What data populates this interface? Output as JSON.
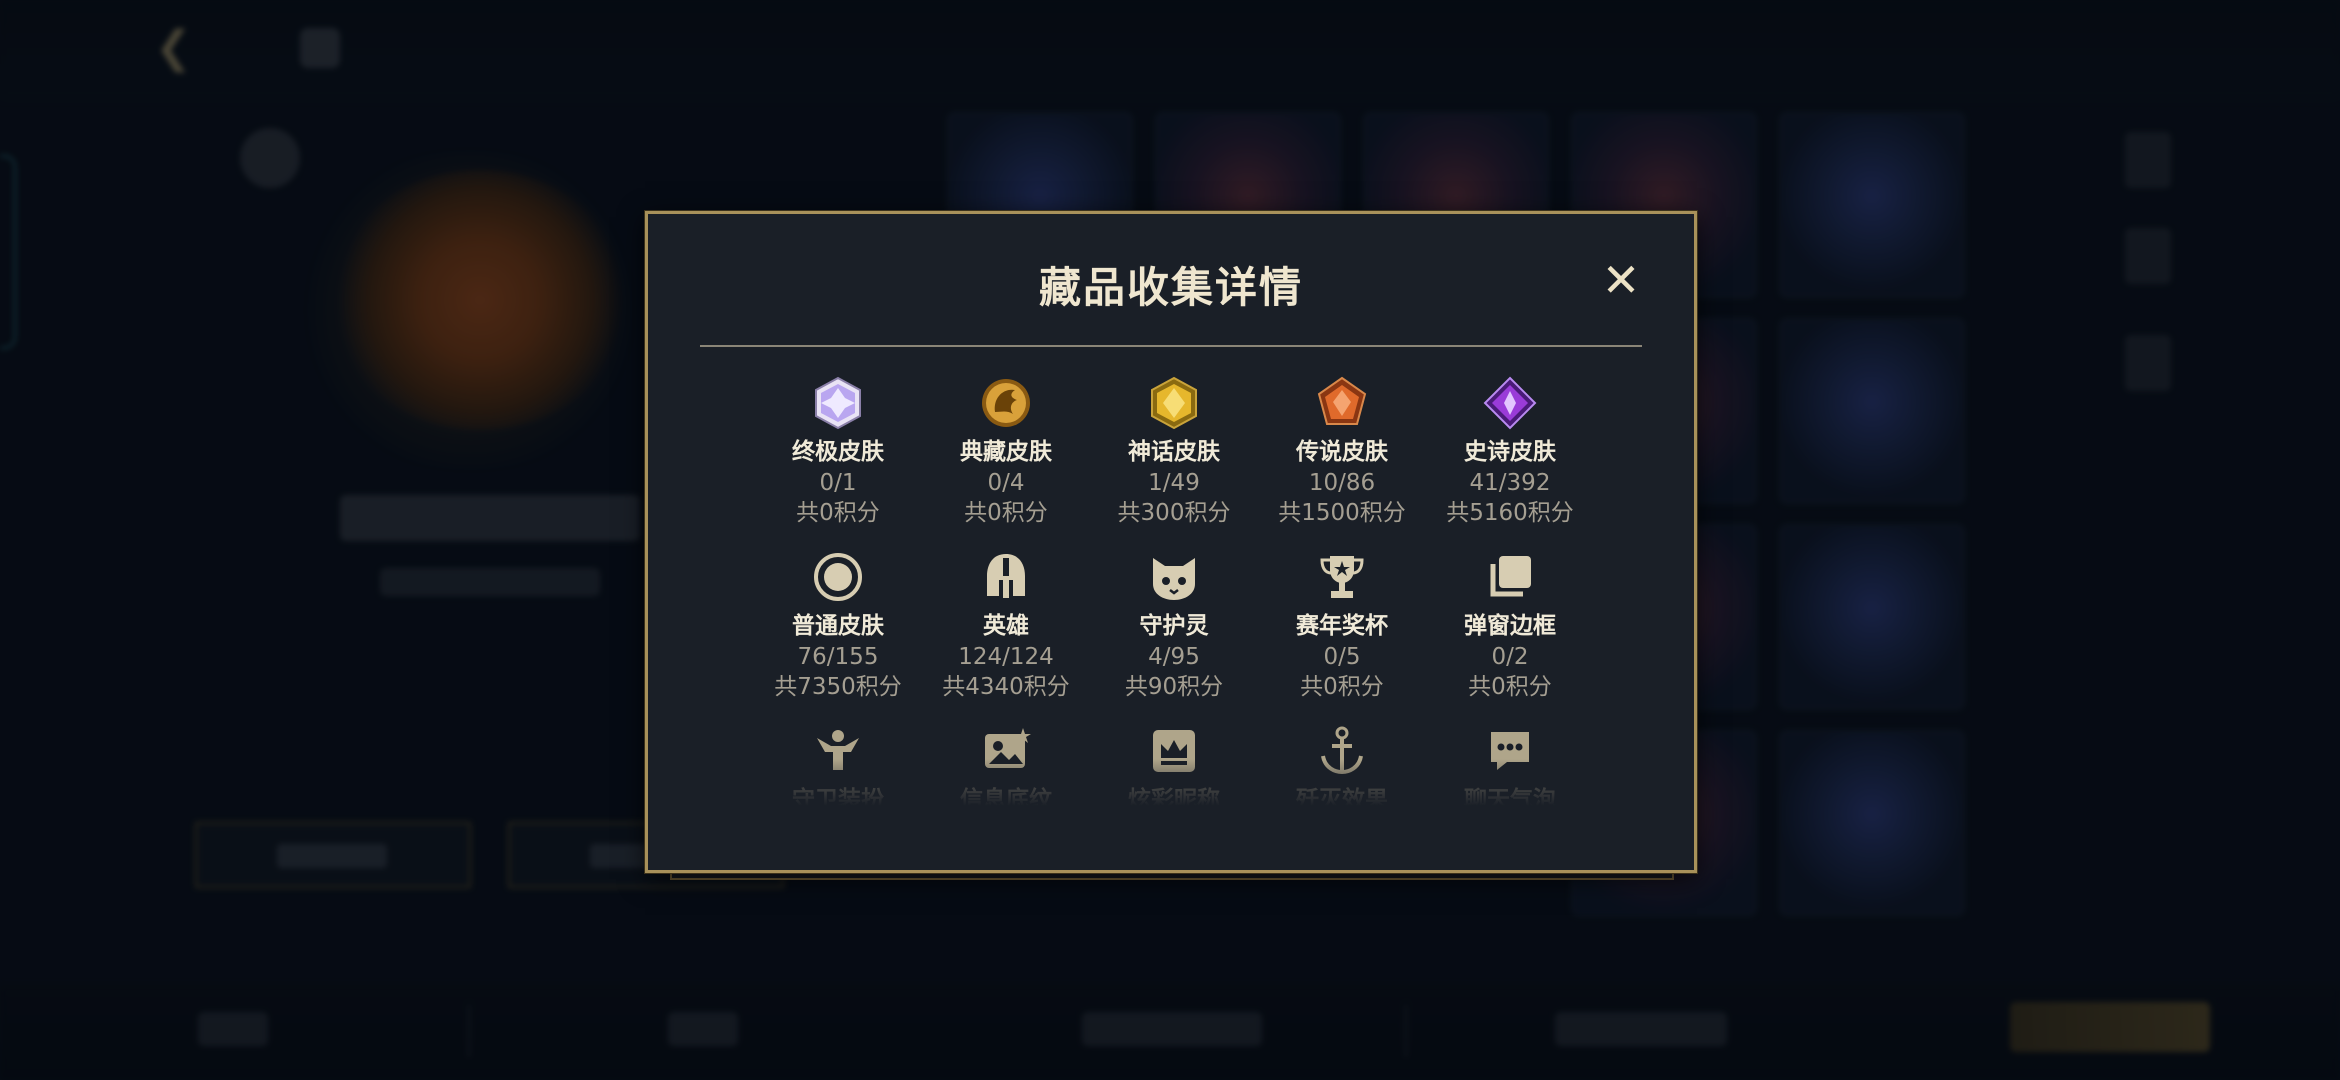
{
  "dialog": {
    "title": "藏品收集详情",
    "close_symbol": "✕",
    "items": [
      {
        "name": "终极皮肤",
        "count": "0/1",
        "points": "共0积分",
        "icon": "ultimate-skin-gem-icon",
        "color": "#b9a6f0"
      },
      {
        "name": "典藏皮肤",
        "count": "0/4",
        "points": "共0积分",
        "icon": "legendary-collection-dragon-icon",
        "color": "#d9a13a"
      },
      {
        "name": "神话皮肤",
        "count": "1/49",
        "points": "共300积分",
        "icon": "mythic-skin-gem-icon",
        "color": "#e6b72c"
      },
      {
        "name": "传说皮肤",
        "count": "10/86",
        "points": "共1500积分",
        "icon": "legend-skin-gem-icon",
        "color": "#e06a2b"
      },
      {
        "name": "史诗皮肤",
        "count": "41/392",
        "points": "共5160积分",
        "icon": "epic-skin-gem-icon",
        "color": "#9a3bd8"
      },
      {
        "name": "普通皮肤",
        "count": "76/155",
        "points": "共7350积分",
        "icon": "normal-skin-ring-icon",
        "color": "#d7cdb2"
      },
      {
        "name": "英雄",
        "count": "124/124",
        "points": "共4340积分",
        "icon": "hero-helmet-icon",
        "color": "#d7cdb2"
      },
      {
        "name": "守护灵",
        "count": "4/95",
        "points": "共90积分",
        "icon": "guardian-spirit-icon",
        "color": "#d7cdb2"
      },
      {
        "name": "赛年奖杯",
        "count": "0/5",
        "points": "共0积分",
        "icon": "season-trophy-icon",
        "color": "#d7cdb2"
      },
      {
        "name": "弹窗边框",
        "count": "0/2",
        "points": "共0积分",
        "icon": "popup-frame-icon",
        "color": "#d7cdb2"
      },
      {
        "name": "守卫装扮",
        "icon": "guard-outfit-icon",
        "color": "#c9bd9c"
      },
      {
        "name": "信息底纹",
        "icon": "info-background-icon",
        "color": "#c9bd9c"
      },
      {
        "name": "炫彩昵称",
        "icon": "colorful-nickname-icon",
        "color": "#c9bd9c"
      },
      {
        "name": "歼灭效果",
        "icon": "annihilation-effect-icon",
        "color": "#c9bd9c"
      },
      {
        "name": "聊天气泡",
        "icon": "chat-bubble-icon",
        "color": "#c9bd9c"
      }
    ]
  },
  "colors": {
    "frame_gold": "#a8915a",
    "dialog_bg": "#1a1f27",
    "title": "#efe6cf",
    "muted_text": "#a59f92"
  }
}
